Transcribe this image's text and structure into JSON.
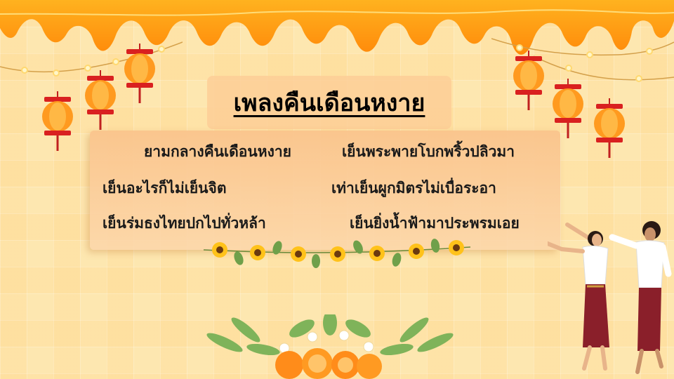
{
  "title": "เพลงคืนเดือนหงาย",
  "lyrics": [
    {
      "left": "ยามกลางคืนเดือนหงาย",
      "right": "เย็นพระพายโบกพริ้วปลิวมา"
    },
    {
      "left": "เย็นอะไรก็ไม่เย็นจิต",
      "right": "เท่าเย็นผูกมิตรไม่เบื่อระอา"
    },
    {
      "left": "เย็นร่มธงไทยปกไปทั่วหล้า",
      "right": "เย็นยิ่งน้ำฟ้ามาประพรมเอย"
    }
  ],
  "colors": {
    "background": "#fde7b0",
    "drip": "#ff9f1a",
    "lantern_body": "#ff9a1f",
    "lantern_cap": "#d92020",
    "title_box": "#fdce96",
    "lyrics_box": "#fac48c"
  },
  "icons": [
    "lantern-icon",
    "sunflower-garland-icon",
    "orange-floral-arrangement-icon",
    "dancers-image"
  ]
}
